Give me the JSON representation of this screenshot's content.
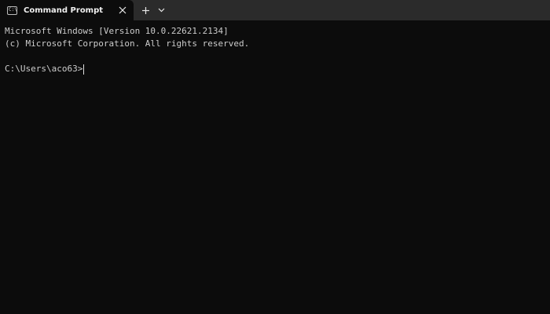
{
  "window": {
    "tab_title": "Command Prompt",
    "tab_icon_glyph": "C:\\"
  },
  "terminal": {
    "lines": [
      "Microsoft Windows [Version 10.0.22621.2134]",
      "(c) Microsoft Corporation. All rights reserved."
    ],
    "prompt": "C:\\Users\\aco63>",
    "input": ""
  },
  "icons": {
    "tab": "terminal-icon",
    "close": "close-icon",
    "new_tab": "plus-icon",
    "dropdown": "chevron-down-icon"
  },
  "colors": {
    "background": "#0c0c0c",
    "tabbar": "#2b2b2b",
    "text": "#cccccc"
  }
}
